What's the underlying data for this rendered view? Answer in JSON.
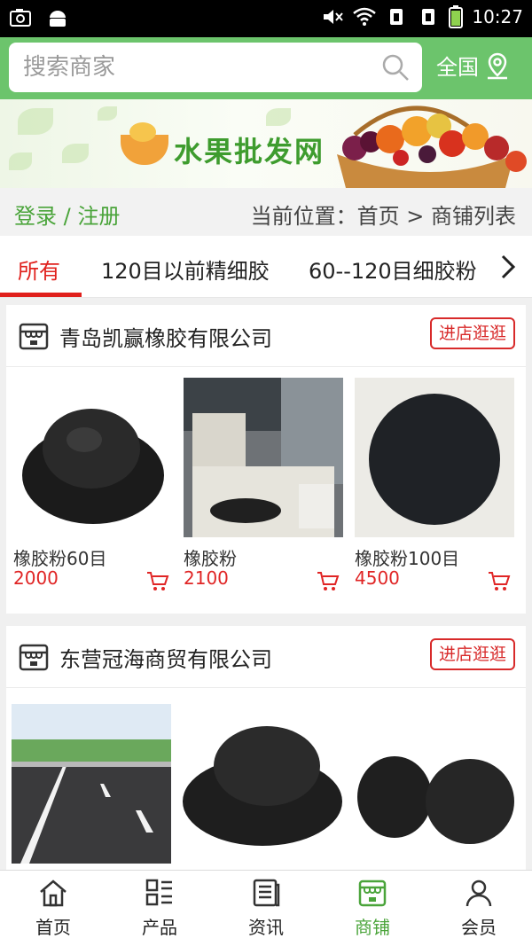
{
  "status_bar": {
    "time": "10:27"
  },
  "search": {
    "placeholder": "搜索商家",
    "region_label": "全国"
  },
  "banner": {
    "title": "水果批发网"
  },
  "breadcrumb": {
    "login_label": "登录 / 注册",
    "location": "当前位置：首页 > 商铺列表"
  },
  "tabs": [
    {
      "label": "所有",
      "active": true
    },
    {
      "label": "120目以前精细胶"
    },
    {
      "label": "60--120目细胶粉"
    }
  ],
  "shops": [
    {
      "name": "青岛凯赢橡胶有限公司",
      "visit_label": "进店逛逛",
      "products": [
        {
          "name": "橡胶粉60目",
          "price": "2000"
        },
        {
          "name": "橡胶粉",
          "price": "2100"
        },
        {
          "name": "橡胶粉100目",
          "price": "4500"
        }
      ]
    },
    {
      "name": "东营冠海商贸有限公司",
      "visit_label": "进店逛逛",
      "products": [
        {
          "name": "",
          "price": ""
        },
        {
          "name": "",
          "price": ""
        },
        {
          "name": "",
          "price": ""
        }
      ]
    }
  ],
  "bottom_nav": [
    {
      "label": "首页",
      "icon": "home-icon"
    },
    {
      "label": "产品",
      "icon": "product-grid-icon"
    },
    {
      "label": "资讯",
      "icon": "news-icon"
    },
    {
      "label": "商铺",
      "icon": "shop-icon",
      "active": true
    },
    {
      "label": "会员",
      "icon": "member-icon"
    }
  ],
  "colors": {
    "accent_green": "#6cc46c",
    "active_red": "#e0201c",
    "price_red": "#e02525"
  }
}
